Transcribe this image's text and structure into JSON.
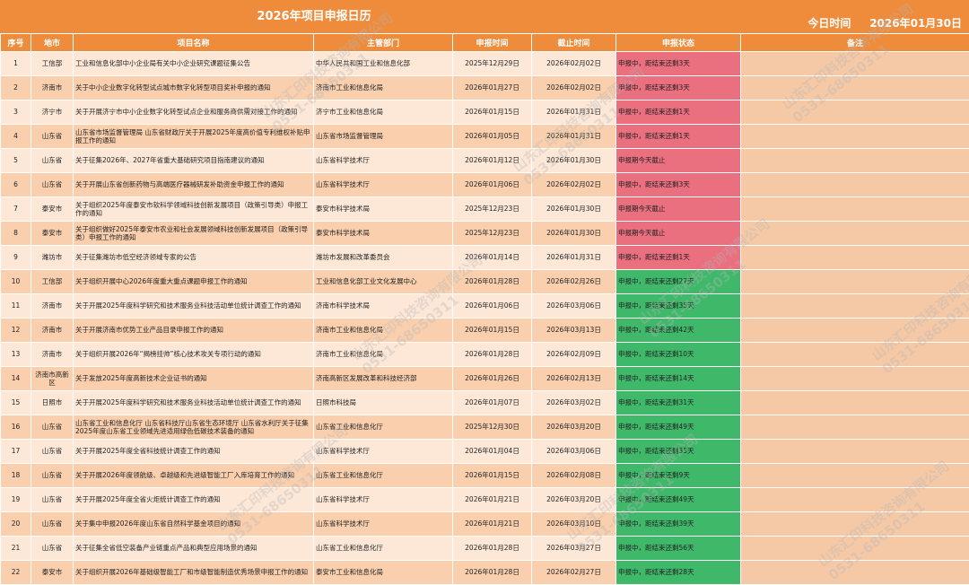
{
  "header": {
    "title": "2026年项目申报日历",
    "today": "今日时间     2026年01月30日"
  },
  "columns": [
    "序号",
    "地市",
    "项目名称",
    "主管部门",
    "申报时间",
    "截止时间",
    "申报状态",
    "备注"
  ],
  "rows": [
    {
      "no": "1",
      "city": "工信部",
      "name": "工业和信息化部中小企业局有关中小企业研究课题征集公告",
      "dept": "中华人民共和国工业和信息化部",
      "start": "2025年12月29日",
      "end": "2026年02月02日",
      "status": "申报中，距结束还剩3天",
      "state": "urgent"
    },
    {
      "no": "2",
      "city": "济南市",
      "name": "关于中小企业数字化转型试点城市数字化转型项目奖补申报的通知",
      "dept": "济南市工业和信息化局",
      "start": "2026年01月27日",
      "end": "2026年02月02日",
      "status": "申报中，距结束还剩3天",
      "state": "urgent"
    },
    {
      "no": "3",
      "city": "济宁市",
      "name": "关于开展济宁市中小企业数字化转型试点企业和服务商供需对接工作的通知",
      "dept": "济宁市工业和信息化局",
      "start": "2026年01月15日",
      "end": "2026年01月31日",
      "status": "申报中，距结束还剩1天",
      "state": "urgent"
    },
    {
      "no": "4",
      "city": "山东省",
      "name": "山东省市场监督管理局 山东省财政厅关于开展2025年度高价值专利维权补贴申报工作的通知",
      "dept": "山东省市场监督管理局",
      "start": "2026年01月05日",
      "end": "2026年01月31日",
      "status": "申报中，距结束还剩1天",
      "state": "urgent"
    },
    {
      "no": "5",
      "city": "山东省",
      "name": "关于征集2026年、2027年省重大基础研究项目指南建议的通知",
      "dept": "山东省科学技术厅",
      "start": "2026年01月12日",
      "end": "2026年01月30日",
      "status": "申报期今天截止",
      "state": "urgent"
    },
    {
      "no": "6",
      "city": "山东省",
      "name": "关于开展山东省创新药物与高端医疗器械研发补助资金申报工作的通知",
      "dept": "山东省科学技术厅",
      "start": "2026年01月06日",
      "end": "2026年02月02日",
      "status": "申报中，距结束还剩3天",
      "state": "urgent"
    },
    {
      "no": "7",
      "city": "泰安市",
      "name": "关于组织2025年度泰安市软科学领域科技创新发展项目（政策引导类）申报工作的通知",
      "dept": "泰安市科学技术局",
      "start": "2025年12月23日",
      "end": "2026年01月30日",
      "status": "申报期今天截止",
      "state": "urgent"
    },
    {
      "no": "8",
      "city": "泰安市",
      "name": "关于组织做好2025年泰安市农业和社会发展领域科技创新发展项目（政策引导类）申报工作的通知",
      "dept": "泰安市科学技术局",
      "start": "2025年12月23日",
      "end": "2026年01月30日",
      "status": "申报期今天截止",
      "state": "urgent"
    },
    {
      "no": "9",
      "city": "潍坊市",
      "name": "关于征集潍坊市低空经济领域专家的公告",
      "dept": "潍坊市发展和改革委员会",
      "start": "2026年01月14日",
      "end": "2026年01月31日",
      "status": "申报中，距结束还剩1天",
      "state": "urgent"
    },
    {
      "no": "10",
      "city": "工信部",
      "name": "关于组织开展中心2026年度重大重点课题申报工作的通知",
      "dept": "工业和信息化部工业文化发展中心",
      "start": "2026年01月28日",
      "end": "2026年02月26日",
      "status": "申报中，距结束还剩27天",
      "state": "ok"
    },
    {
      "no": "11",
      "city": "济南市",
      "name": "关于开展2025年度科学研究和技术服务业科技活动单位统计调查工作的通知",
      "dept": "济南市科学技术局",
      "start": "2026年01月06日",
      "end": "2026年03月06日",
      "status": "申报中，距结束还剩35天",
      "state": "ok"
    },
    {
      "no": "12",
      "city": "济南市",
      "name": "关于开展济南市优势工业产品目录申报工作的通知",
      "dept": "济南市工业和信息化局",
      "start": "2026年01月15日",
      "end": "2026年03月13日",
      "status": "申报中，距结束还剩42天",
      "state": "ok"
    },
    {
      "no": "13",
      "city": "济南市",
      "name": "关于组织开展2026年“揭榜挂帅”核心技术攻关专项行动的通知",
      "dept": "济南市工业和信息化局",
      "start": "2026年01月28日",
      "end": "2026年02月09日",
      "status": "申报中，距结束还剩10天",
      "state": "ok"
    },
    {
      "no": "14",
      "city": "济南市高新区",
      "name": "关于发放2025年度高新技术企业证书的通知",
      "dept": "济南高新区发展改革和科技经济部",
      "start": "2026年01月26日",
      "end": "2026年02月13日",
      "status": "申报中，距结束还剩14天",
      "state": "ok"
    },
    {
      "no": "15",
      "city": "日照市",
      "name": "关于开展2025年度科学研究和技术服务业科技活动单位统计调查工作的通知",
      "dept": "日照市科技局",
      "start": "2026年01月07日",
      "end": "2026年03月02日",
      "status": "申报中，距结束还剩31天",
      "state": "ok"
    },
    {
      "no": "16",
      "city": "山东省",
      "name": "山东省工业和信息化厅 山东省科技厅山东省生态环境厅 山东省水利厅关于征集2025年度山东省工业领域先进适用绿色低碳技术装备的通知",
      "dept": "山东省工业和信息化厅",
      "start": "2025年12月30日",
      "end": "2026年03月20日",
      "status": "申报中，距结束还剩49天",
      "state": "ok"
    },
    {
      "no": "17",
      "city": "山东省",
      "name": "关于开展2025年度全省科技统计调查工作的通知",
      "dept": "山东省科学技术厅",
      "start": "2026年01月04日",
      "end": "2026年03月06日",
      "status": "申报中，距结束还剩35天",
      "state": "ok"
    },
    {
      "no": "18",
      "city": "山东省",
      "name": "关于开展2026年度领航级、卓越级和先进级智能工厂入库培育工作的通知",
      "dept": "山东省工业和信息化厅",
      "start": "2026年01月15日",
      "end": "2026年02月08日",
      "status": "申报中，距结束还剩9天",
      "state": "ok"
    },
    {
      "no": "19",
      "city": "山东省",
      "name": "关于开展2025年度全省火炬统计调查工作的通知",
      "dept": "山东省科学技术厅",
      "start": "2026年01月21日",
      "end": "2026年03月20日",
      "status": "申报中，距结束还剩49天",
      "state": "ok"
    },
    {
      "no": "20",
      "city": "山东省",
      "name": "关于集中申报2026年度山东省自然科学基金项目的通知",
      "dept": "山东省科学技术厅",
      "start": "2026年01月21日",
      "end": "2026年03月10日",
      "status": "申报中，距结束还剩39天",
      "state": "ok"
    },
    {
      "no": "21",
      "city": "山东省",
      "name": "关于征集全省低空装备产业链重点产品和典型应用场景的通知",
      "dept": "山东省工业和信息化厅",
      "start": "2026年01月28日",
      "end": "2026年03月27日",
      "status": "申报中，距结束还剩56天",
      "state": "ok"
    },
    {
      "no": "22",
      "city": "泰安市",
      "name": "关于组织开展2026年基础级智能工厂和市级智能制造优秀场景申报工作的通知",
      "dept": "泰安市工业和信息化局",
      "start": "2026年01月28日",
      "end": "2026年02月27日",
      "status": "申报中，距结束还剩28天",
      "state": "ok"
    }
  ],
  "watermark": {
    "lines": [
      "山东汇印科技咨询有限公司",
      "0531-68650311"
    ]
  },
  "colors": {
    "header": "#ee8c3c",
    "row_light": "#fde8d8",
    "row_dark": "#f9cfae",
    "urgent": "#ea6f7f",
    "ok": "#3fb86a"
  }
}
